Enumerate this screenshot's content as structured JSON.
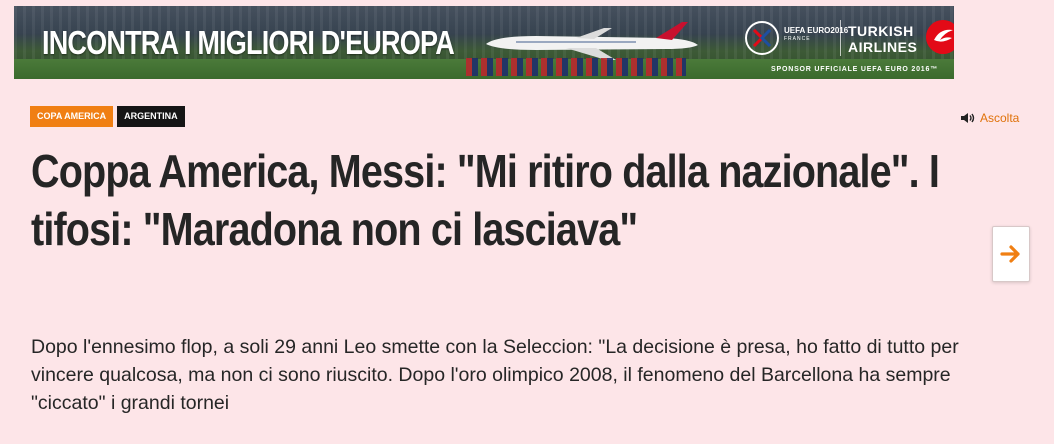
{
  "banner": {
    "headline": "INCONTRA I MIGLIORI D'EUROPA",
    "euro_label": "UEFA EURO2016",
    "euro_sub": "FRANCE",
    "airline_line1": "TURKISH",
    "airline_line2": "AIRLINES",
    "sponsor": "SPONSOR UFFICIALE UEFA EURO 2016™"
  },
  "tags": [
    {
      "label": "COPA AMERICA",
      "color": "#f07f13"
    },
    {
      "label": "ARGENTINA",
      "color": "#151515"
    }
  ],
  "listen": {
    "label": "Ascolta",
    "icon": "speaker-icon",
    "color": "#e0720a"
  },
  "article": {
    "title": "Coppa America, Messi: \"Mi ritiro dalla nazionale\". I tifosi: \"Maradona non ci lasciava\"",
    "summary": "Dopo l'ennesimo flop, a soli 29 anni Leo smette con la Seleccion: \"La decisione è presa, ho fatto di tutto per vincere qualcosa, ma non ci sono riuscito. Dopo l'oro olimpico 2008, il fenomeno del Barcellona ha sempre \"ciccato\" i grandi tornei"
  },
  "next_button": {
    "icon": "arrow-right-icon",
    "color": "#f07f13"
  },
  "colors": {
    "background": "#fde5e8",
    "accent": "#f07f13",
    "text": "#252525"
  }
}
